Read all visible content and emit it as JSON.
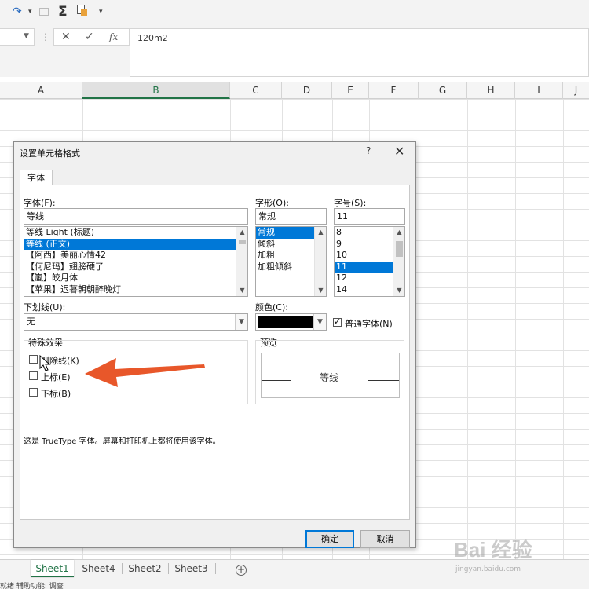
{
  "formula_bar": {
    "cell_value": "120m2"
  },
  "columns": [
    {
      "label": "A"
    },
    {
      "label": "B",
      "selected": true
    },
    {
      "label": "C"
    },
    {
      "label": "D"
    },
    {
      "label": "E"
    },
    {
      "label": "F"
    },
    {
      "label": "G"
    },
    {
      "label": "H"
    },
    {
      "label": "I"
    },
    {
      "label": "J"
    }
  ],
  "sheets": [
    {
      "label": "Sheet1",
      "active": true
    },
    {
      "label": "Sheet4"
    },
    {
      "label": "Sheet2"
    },
    {
      "label": "Sheet3"
    }
  ],
  "status_bar": {
    "text": "就绪 辅助功能: 调查"
  },
  "dialog": {
    "title": "设置单元格格式",
    "help": "?",
    "close": "✕",
    "tab_label": "字体",
    "font": {
      "label": "字体(F):",
      "value": "等线",
      "items": [
        "等线 Light (标题)",
        "等线 (正文)",
        "【阿西】美丽心情42",
        "【何尼玛】翅膀硬了",
        "【嵐】皎月体",
        "【苹果】迟暮朝朝醉晚灯"
      ],
      "selected_index": 1
    },
    "style": {
      "label": "字形(O):",
      "value": "常规",
      "items": [
        "常规",
        "倾斜",
        "加粗",
        "加粗倾斜"
      ],
      "selected_index": 0
    },
    "size": {
      "label": "字号(S):",
      "value": "11",
      "items": [
        "8",
        "9",
        "10",
        "11",
        "12",
        "14"
      ],
      "selected_index": 3
    },
    "underline": {
      "label": "下划线(U):",
      "value": "无"
    },
    "color": {
      "label": "颜色(C):",
      "swatch": "#000000",
      "normal_font_label": "普通字体(N)",
      "normal_font_checked": true
    },
    "effects": {
      "label": "特殊效果",
      "strikethrough": "删除线(K)",
      "superscript": "上标(E)",
      "subscript": "下标(B)"
    },
    "preview": {
      "label": "预览",
      "sample": "等线"
    },
    "note": "这是 TrueType 字体。屏幕和打印机上都将使用该字体。",
    "ok_label": "确定",
    "cancel_label": "取消"
  },
  "annotation": {
    "arrow_color": "#e8572a"
  },
  "watermark": {
    "brand": "Bai 经验",
    "url": "jingyan.baidu.com"
  }
}
